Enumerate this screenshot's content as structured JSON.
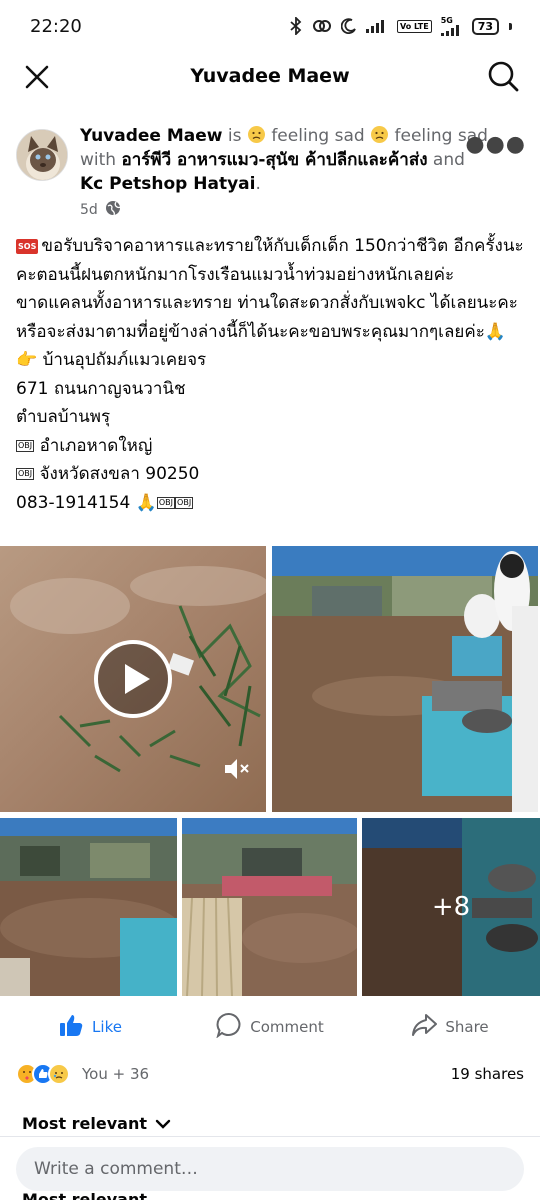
{
  "status": {
    "time": "22:20",
    "network": "5G",
    "volte": "Vo LTE",
    "battery": "73"
  },
  "header": {
    "title": "Yuvadee Maew"
  },
  "post": {
    "author": "Yuvadee Maew",
    "is_text": "is",
    "feeling": "feeling sad",
    "feeling_repeat": "feeling sad",
    "with_text": "with",
    "tagged_1": "อาร์พีวี อาหารแมว-สุนัข ค้าปลีกและค้าส่ง",
    "and_text": "and",
    "tagged_2": "Kc Petshop Hatyai",
    "period": ".",
    "time_ago": "5d",
    "sos_label": "SOS",
    "body_line1": "ขอรับบริจาคอาหารและทรายให้กับเด็กเด็ก 150กว่าชีวิต อีกครั้งนะคะตอนนี้ฝนตกหนักมากโรงเรือนแมวน้ำท่วมอย่างหนักเลยค่ะขาดแคลนทั้งอาหารและทราย ท่านใดสะดวกสั่งกับเพจkc ได้เลยนะคะหรือจะส่งมาตามที่อยู่ข้างล่างนี้ก็ได้นะคะขอบพระคุณมากๆเลยค่ะ🙏",
    "address_name": "👉 บ้านอุปถัมภ์แมวเคยจร",
    "address_street": "671 ถนนกาญจนวานิช",
    "address_subdistrict": "ตำบลบ้านพรุ",
    "address_district": "อำเภอหาดใหญ่",
    "address_province": "จังหวัดสงขลา 90250",
    "phone": "083-1914154 🙏",
    "obj_label": "OBJ"
  },
  "media": {
    "more_count": "+8"
  },
  "actions": {
    "like": "Like",
    "comment": "Comment",
    "share": "Share"
  },
  "reactions": {
    "summary": "You + 36",
    "shares": "19 shares"
  },
  "comments": {
    "sort_label": "Most relevant",
    "input_placeholder": "Write a comment…",
    "peek_label": "Most relevant"
  },
  "colors": {
    "brand_blue": "#1877f2",
    "secondary_text": "#65676b",
    "sos_red": "#d9342b"
  }
}
